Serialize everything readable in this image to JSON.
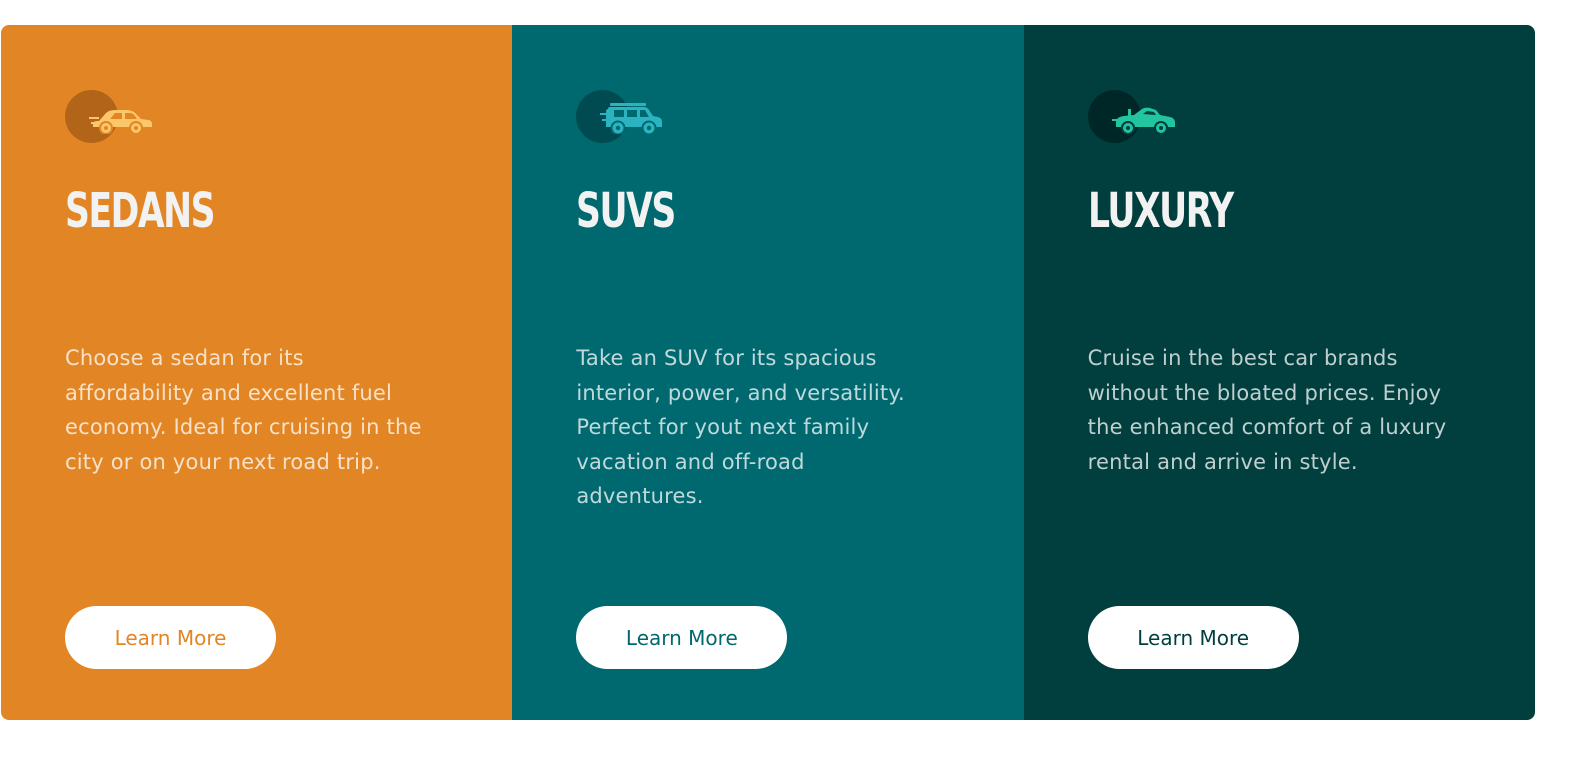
{
  "cards": [
    {
      "icon": "sedan-car-icon",
      "icon_color": "#fbc76a",
      "title": "SEDANS",
      "description": "Choose a sedan for its affordability and excellent fuel economy. Ideal for cruising in the city or on your next road trip.",
      "button_label": "Learn More",
      "background": "#e28625"
    },
    {
      "icon": "suv-car-icon",
      "icon_color": "#2bb3c0",
      "title": "SUVS",
      "description": "Take an SUV for its spacious interior, power, and versatility. Perfect for yout next family vacation and off-road adventures.",
      "button_label": "Learn More",
      "background": "#006970"
    },
    {
      "icon": "luxury-car-icon",
      "icon_color": "#23c4a0",
      "title": "LUXURY",
      "description": "Cruise in the best car brands without the bloated prices. Enjoy the enhanced comfort of a luxury rental and arrive in style.",
      "button_label": "Learn More",
      "background": "#003f3e"
    }
  ]
}
